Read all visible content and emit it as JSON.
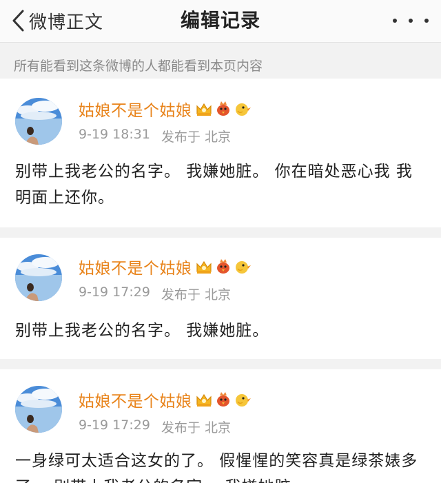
{
  "nav": {
    "back_label": "微博正文",
    "title": "编辑记录",
    "back_icon": "chevron-left-icon",
    "more_icon": "more-dots-icon"
  },
  "notice": "所有能看到这条微博的人都能看到本页内容",
  "colors": {
    "username": "#e8831a",
    "meta": "#9a9a9a",
    "notice": "#8a8a8a",
    "background": "#f2f2f2"
  },
  "posts": [
    {
      "username": "姑娘不是个姑娘",
      "time": "9-19 18:31",
      "location": "发布于 北京",
      "content": "别带上我老公的名字。  我嫌她脏。 你在暗处恶心我  我明面上还你。"
    },
    {
      "username": "姑娘不是个姑娘",
      "time": "9-19 17:29",
      "location": "发布于 北京",
      "content": "别带上我老公的名字。  我嫌她脏。"
    },
    {
      "username": "姑娘不是个姑娘",
      "time": "9-19 17:29",
      "location": "发布于 北京",
      "content": "一身绿可太适合这女的了。 假惺惺的笑容真是绿茶婊多了。 别带上我老公的名字。 我嫌她脏。"
    }
  ]
}
